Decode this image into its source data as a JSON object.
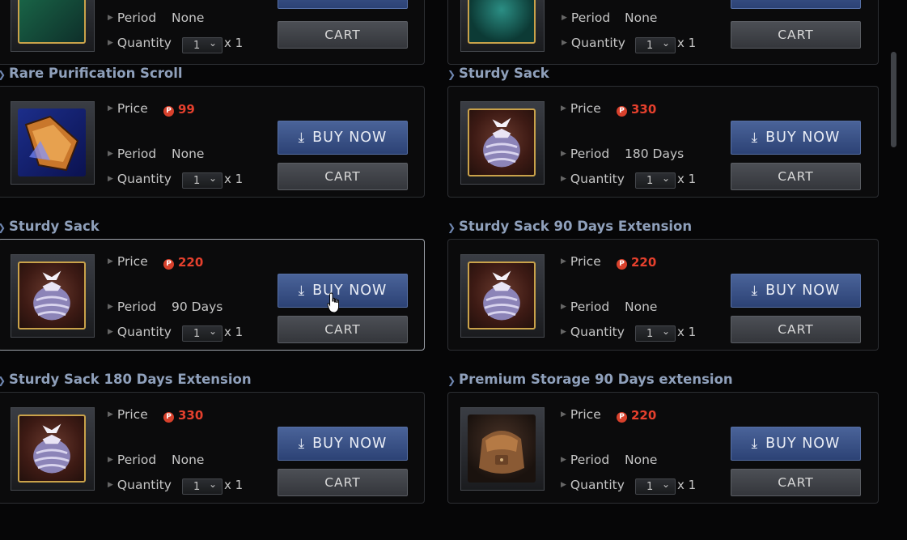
{
  "labels": {
    "price": "Price",
    "period": "Period",
    "quantity": "Quantity",
    "times": "x 1",
    "buy_now": "BUY NOW",
    "cart": "CART",
    "coin": "P"
  },
  "colors": {
    "price": "#e5402d",
    "title": "#8fa0bb",
    "buy_button": "#3b5287",
    "cart_button": "#43464b"
  },
  "top_row": [
    {
      "period": "None",
      "quantity": "1"
    },
    {
      "period": "None",
      "quantity": "1"
    }
  ],
  "items": [
    {
      "title": "Rare Purification Scroll",
      "price": "99",
      "period": "None",
      "quantity": "1",
      "icon": "scroll-icon"
    },
    {
      "title": "Sturdy Sack",
      "price": "330",
      "period": "180 Days",
      "quantity": "1",
      "icon": "sack-icon"
    },
    {
      "title": "Sturdy Sack",
      "price": "220",
      "period": "90 Days",
      "quantity": "1",
      "icon": "sack-icon"
    },
    {
      "title": "Sturdy Sack 90 Days Extension",
      "price": "220",
      "period": "None",
      "quantity": "1",
      "icon": "sack-icon"
    },
    {
      "title": "Sturdy Sack 180 Days Extension",
      "price": "330",
      "period": "None",
      "quantity": "1",
      "icon": "sack-icon"
    },
    {
      "title": "Premium Storage 90 Days extension",
      "price": "220",
      "period": "None",
      "quantity": "1",
      "icon": "backpack-icon"
    }
  ]
}
